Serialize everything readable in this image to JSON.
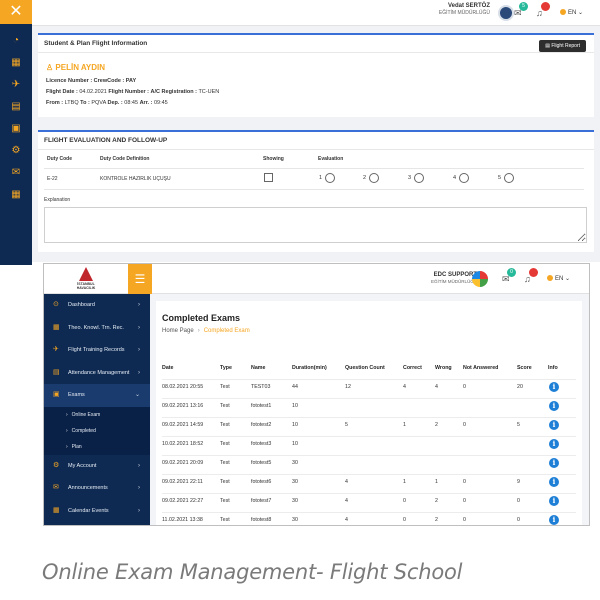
{
  "top": {
    "close_glyph": "✕",
    "user": {
      "name": "Vedat SERTÖZ",
      "role": "EĞİTİM MÜDÜRLÜĞÜ",
      "message_badge": "5"
    },
    "language": "EN",
    "flight_info": {
      "title": "Student & Plan Flight Information",
      "report_button": "Flight Report",
      "pilot_name": "PELİN AYDIN",
      "licence_label": "Licence Number : CrewCode : PAY",
      "flight_date_label": "Flight Date :",
      "flight_date": "04.02.2021",
      "flight_number_label": "Flight Number :",
      "ac_reg_label": "A/C Registration :",
      "ac_reg": "TC-UEN",
      "from_label": "From :",
      "from": "LTBQ",
      "to_label": "To :",
      "to": "PQVA",
      "dep_label": "Dep. :",
      "dep": "08:45",
      "arr_label": "Arr. :",
      "arr": "09:45"
    },
    "evaluation": {
      "title": "FLIGHT EVALUATION AND FOLLOW-UP",
      "headers": {
        "duty_code": "Duty Code",
        "definition": "Duty Code Definition",
        "showing": "Showing",
        "evaluation": "Evaluation"
      },
      "row": {
        "duty_code": "E-22",
        "definition": "KONTROLE HAZIRLIK UÇUŞU"
      },
      "scale": [
        "1",
        "2",
        "3",
        "4",
        "5"
      ],
      "explanation_label": "Explanation"
    }
  },
  "bottom": {
    "logo_text_1": "İSTANBUL",
    "logo_text_2": "HAVACILIK",
    "user": {
      "name": "EDC SUPPORT",
      "role": "EĞİTİM MÜDÜRLÜĞÜ",
      "message_badge": "0"
    },
    "language": "EN",
    "sidebar": {
      "items": [
        {
          "label": "Dashboard",
          "icon": "⊙"
        },
        {
          "label": "Theo. Knowl. Trn. Rec.",
          "icon": "▦"
        },
        {
          "label": "Flight Training Records",
          "icon": "✈"
        },
        {
          "label": "Attendance Management",
          "icon": "▤"
        },
        {
          "label": "Exams",
          "icon": "▣"
        }
      ],
      "sub_items": [
        "Online Exam",
        "Completed",
        "Plan"
      ],
      "more_items": [
        {
          "label": "My Account",
          "icon": "⚙"
        },
        {
          "label": "Announcements",
          "icon": "✉"
        },
        {
          "label": "Calendar Events",
          "icon": "▦"
        }
      ]
    },
    "page": {
      "title": "Completed Exams",
      "crumb_home": "Home Page",
      "crumb_current": "Completed Exam"
    },
    "table": {
      "headers": [
        "Date",
        "Type",
        "Name",
        "Duration(min)",
        "Question Count",
        "Correct",
        "Wrong",
        "Not Answered",
        "Score",
        "Info"
      ],
      "rows": [
        [
          "08.02.2021 20:55",
          "Test",
          "TEST03",
          "44",
          "12",
          "4",
          "4",
          "0",
          "20"
        ],
        [
          "09.02.2021 13:16",
          "Test",
          "fototest1",
          "10",
          "",
          "",
          "",
          "",
          ""
        ],
        [
          "09.02.2021 14:59",
          "Test",
          "fototest2",
          "10",
          "5",
          "1",
          "2",
          "0",
          "5"
        ],
        [
          "10.02.2021 18:52",
          "Test",
          "fototest3",
          "10",
          "",
          "",
          "",
          "",
          ""
        ],
        [
          "09.02.2021 20:09",
          "Test",
          "fototest5",
          "30",
          "",
          "",
          "",
          "",
          ""
        ],
        [
          "09.02.2021 22:11",
          "Test",
          "fototest6",
          "30",
          "4",
          "1",
          "1",
          "0",
          "9"
        ],
        [
          "09.02.2021 22:27",
          "Test",
          "fototest7",
          "30",
          "4",
          "0",
          "2",
          "0",
          "0"
        ],
        [
          "11.02.2021 13:38",
          "Test",
          "fototest8",
          "30",
          "4",
          "0",
          "2",
          "0",
          "0"
        ]
      ],
      "info_glyph": "i"
    }
  },
  "caption": "Online Exam Management- Flight School",
  "colors": {
    "navy": "#0e2a52",
    "accent": "#f5a623",
    "info_blue": "#1e7fd6"
  }
}
